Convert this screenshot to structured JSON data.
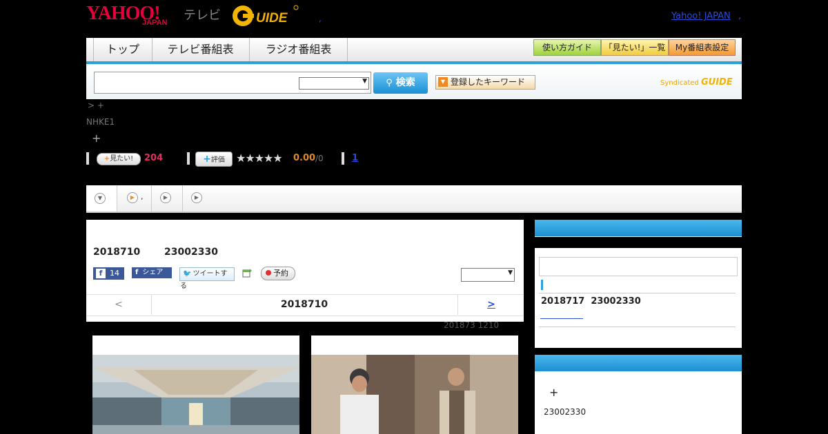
{
  "header": {
    "logo_yahoo": "YAHOO!",
    "logo_japan": "JAPAN",
    "logo_tv": "テレビ",
    "logo_gguide": "G GUIDE",
    "yahoo_japan_link": "Yahoo! JAPAN",
    "dot_link": ",",
    "dot_small": ","
  },
  "nav": {
    "items": [
      "トップ",
      "テレビ番組表",
      "ラジオ番組表"
    ],
    "right_buttons": [
      "使い方ガイド",
      "「見たい!」一覧",
      "My番組表設定"
    ]
  },
  "search": {
    "button_label": "検索",
    "keyword_button": "登録したキーワード",
    "syndicated": "Syndicated",
    "syndicated_logo": "GUIDE"
  },
  "breadcrumb": "> +",
  "channel": "NHKE1",
  "plus": "+",
  "ratings": {
    "want_label": "見たい!",
    "want_count": "204",
    "eval_label": "評価",
    "stars": "★★★★★",
    "score": "0.00",
    "score_count": "/0",
    "link": "1"
  },
  "tabs": [
    ",",
    "",
    ""
  ],
  "program": {
    "date": "2018710",
    "time": "23002330",
    "fb_like_count": "14",
    "fb_share": "シェア",
    "tweet": "ツイートする",
    "reserve": "予約"
  },
  "pager": {
    "prev": "<",
    "current": "2018710",
    "next": ">"
  },
  "updated": "201873  1210",
  "sidebar": {
    "next_date": "2018717",
    "next_time": "23002330",
    "box2_plus": "+",
    "box2_time": "23002330"
  },
  "colors": {
    "accent": "#2a9fd8",
    "brand_red": "#e4003a",
    "want_pink": "#e03060",
    "score_orange": "#e08a30"
  }
}
